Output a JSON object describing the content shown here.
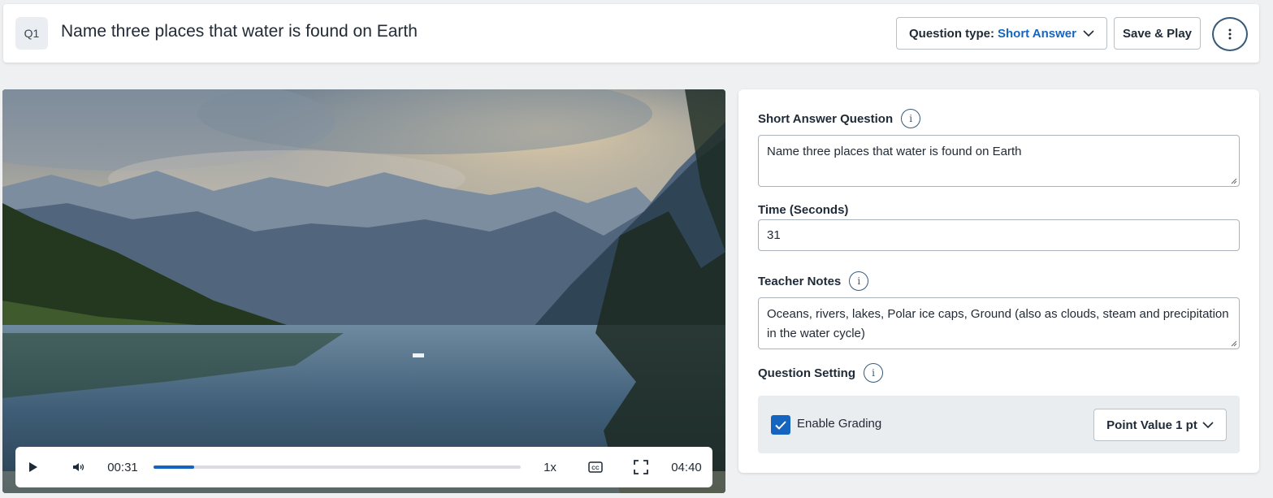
{
  "header": {
    "question_badge": "Q1",
    "question_title": "Name three places that water is found on Earth",
    "question_type_label": "Question type:",
    "question_type_value": "Short Answer",
    "save_play_label": "Save & Play",
    "more_icon": "vertical-ellipsis-icon"
  },
  "video": {
    "current_time": "00:31",
    "duration": "04:40",
    "progress_fraction": 0.11,
    "speed": "1x",
    "icons": [
      "play-icon",
      "volume-icon",
      "closed-captions-icon",
      "fullscreen-icon"
    ]
  },
  "panel": {
    "question": {
      "label": "Short Answer Question",
      "value": "Name three places that water is found on Earth"
    },
    "time": {
      "label": "Time (Seconds)",
      "value": "31"
    },
    "teacher_notes": {
      "label": "Teacher Notes",
      "value": "Oceans, rivers, lakes, Polar ice caps, Ground (also as clouds, steam and precipitation in the water cycle)"
    },
    "question_setting": {
      "label": "Question Setting",
      "enable_grading_label": "Enable Grading",
      "enable_grading_checked": true,
      "point_value_label": "Point Value 1 pt"
    }
  },
  "colors": {
    "accent": "#1565c0",
    "background": "#eef0f2",
    "panel": "#ffffff",
    "info_icon": "#355a7a"
  }
}
